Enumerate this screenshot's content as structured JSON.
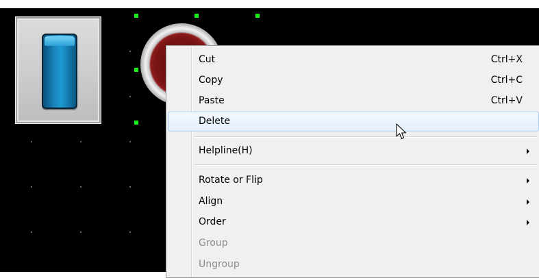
{
  "context_menu": {
    "items": [
      {
        "label": "Cut",
        "shortcut": "Ctrl+X"
      },
      {
        "label": "Copy",
        "shortcut": "Ctrl+C"
      },
      {
        "label": "Paste",
        "shortcut": "Ctrl+V"
      },
      {
        "label": "Delete",
        "state": "highlighted"
      },
      {
        "label": "Helpline(H)",
        "submenu": true
      },
      {
        "label": "Rotate or Flip",
        "submenu": true
      },
      {
        "label": "Align",
        "submenu": true
      },
      {
        "label": "Order",
        "submenu": true
      },
      {
        "label": "Group",
        "state": "disabled"
      },
      {
        "label": "Ungroup",
        "state": "disabled"
      }
    ]
  },
  "colors": {
    "canvas": "#000000",
    "grid_dot": "#8a8a8a",
    "selection_handle": "#1cf01c",
    "menu_background": "#f0f0f0",
    "menu_highlight_border": "#a9cbef",
    "disabled_text": "#8c8c8c",
    "toggle_lever": "#1a86bd",
    "round_button": "#7a1414"
  },
  "icons": {
    "cursor": "mouse-pointer-icon",
    "submenu_arrow": "chevron-right-icon"
  }
}
